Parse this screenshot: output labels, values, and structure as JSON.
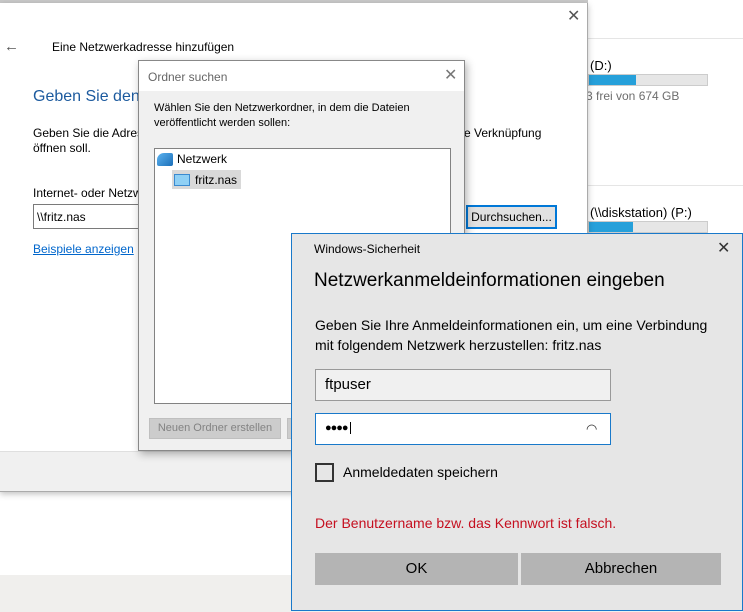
{
  "explorer": {
    "drive_d_label": "(D:)",
    "drive_d_free": "3 frei von 674 GB",
    "drive_d_used_fraction": 0.4,
    "drive_p_label": "(\\\\diskstation) (P:)",
    "drive_p_used_fraction": 0.37
  },
  "wizard": {
    "title": "Eine Netzwerkadresse hinzufügen",
    "heading": "Geben Sie den ",
    "desc_line1_left": "Geben Sie die Adres",
    "desc_line1_right": "e Verknüpfung",
    "desc_line2": "öffnen soll.",
    "address_label": "Internet- oder Netzw",
    "address_value": "\\\\fritz.nas",
    "browse_button": "Durchsuchen...",
    "examples_link": "Beispiele anzeigen"
  },
  "ordner": {
    "title": "Ordner suchen",
    "instruction": "Wählen Sie den Netzwerkordner, in dem die Dateien veröffentlicht werden sollen:",
    "tree": [
      {
        "label": "Netzwerk"
      },
      {
        "label": "fritz.nas",
        "selected": true
      }
    ],
    "new_folder_button": "Neuen Ordner erstellen"
  },
  "security": {
    "window_title": "Windows-Sicherheit",
    "heading": "Netzwerkanmeldeinformationen eingeben",
    "description": "Geben Sie Ihre Anmeldeinformationen ein, um eine Verbindung mit folgendem Netzwerk herzustellen: fritz.nas",
    "username": "ftpuser",
    "password_mask": "●●●●",
    "remember_label": "Anmeldedaten speichern",
    "remember_checked": false,
    "error": "Der Benutzername bzw. das Kennwort ist falsch.",
    "ok_button": "OK",
    "cancel_button": "Abbrechen",
    "error_color": "#c50f1f",
    "accent": "#1979ca"
  }
}
